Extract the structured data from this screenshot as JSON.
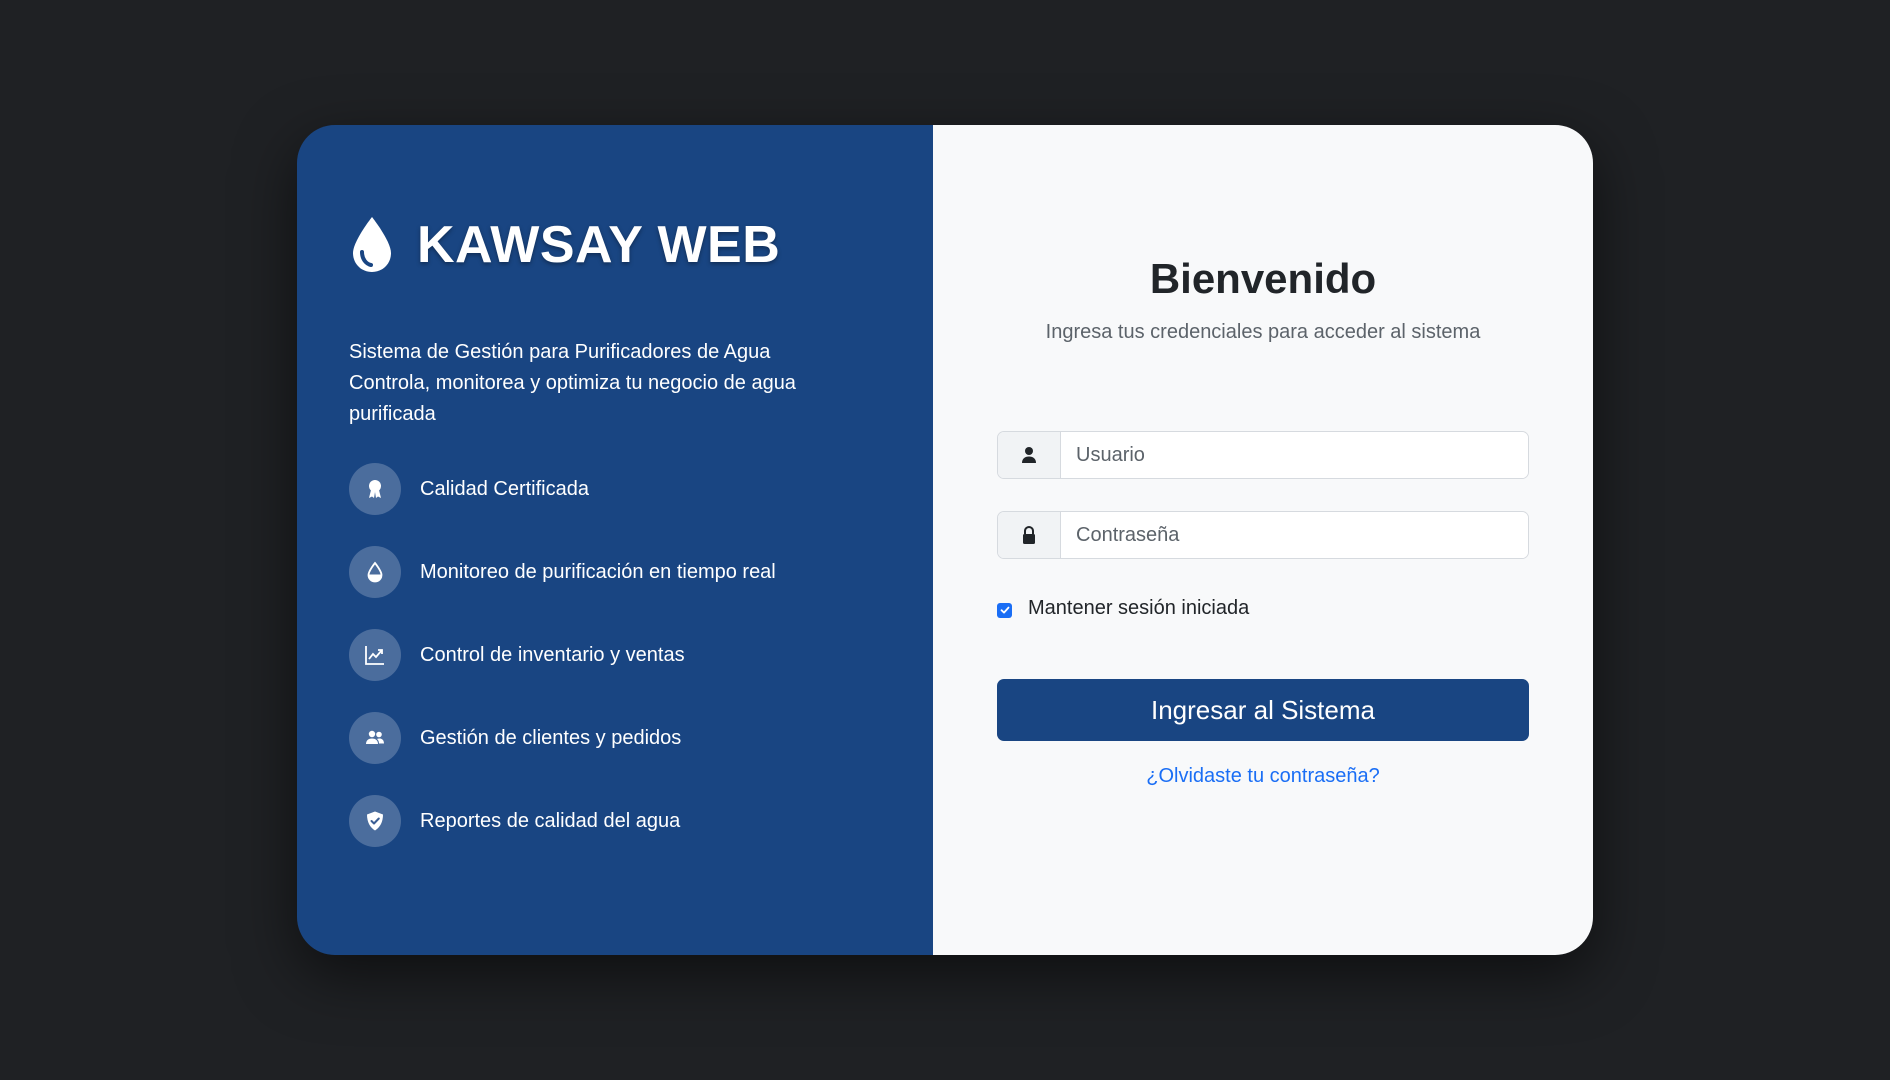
{
  "brand": {
    "title": "KAWSAY WEB",
    "icon": "water-drop-icon"
  },
  "description": {
    "line1": "Sistema de Gestión para Purificadores de Agua",
    "line2": "Controla, monitorea y optimiza tu negocio de agua purificada"
  },
  "features": [
    {
      "label": "Calidad Certificada",
      "icon": "award-icon"
    },
    {
      "label": "Monitoreo de purificación en tiempo real",
      "icon": "droplet-half-icon"
    },
    {
      "label": "Control de inventario y ventas",
      "icon": "graph-up-icon"
    },
    {
      "label": "Gestión de clientes y pedidos",
      "icon": "people-icon"
    },
    {
      "label": "Reportes de calidad del agua",
      "icon": "shield-check-icon"
    }
  ],
  "login": {
    "title": "Bienvenido",
    "subtitle": "Ingresa tus credenciales para acceder al sistema",
    "username_placeholder": "Usuario",
    "username_value": "",
    "password_placeholder": "Contraseña",
    "password_value": "",
    "remember_label": "Mantener sesión iniciada",
    "remember_checked": true,
    "submit_label": "Ingresar al Sistema",
    "forgot_label": "¿Olvidaste tu contraseña?"
  },
  "colors": {
    "page_background": "#1f2124",
    "brand_blue": "#194582",
    "link_blue": "#1a6ef5",
    "panel_light": "#f8f9fa"
  }
}
